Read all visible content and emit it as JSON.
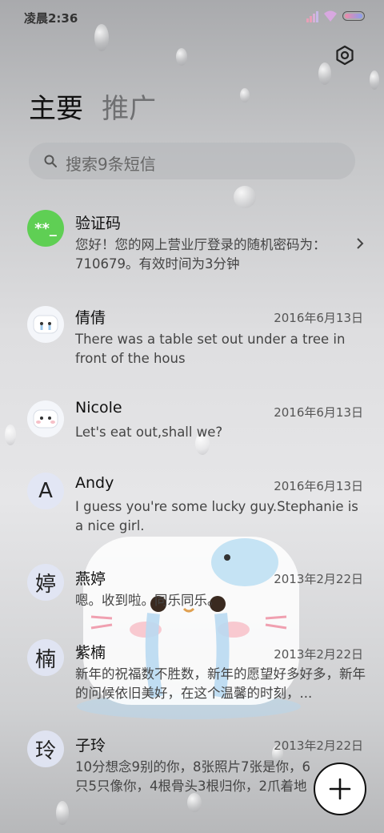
{
  "status_bar": {
    "time": "凌晨2:36"
  },
  "tabs": [
    {
      "label": "主要"
    },
    {
      "label": "推广"
    }
  ],
  "search": {
    "placeholder": "搜索9条短信"
  },
  "messages": [
    {
      "avatar": "**_",
      "name": "验证码",
      "date": "",
      "preview": "您好！您的网上营业厅登录的随机密码为：710679。有效时间为3分钟"
    },
    {
      "avatar": "cat-sticker",
      "name": "倩倩",
      "date": "2016年6月13日",
      "preview": "There was a table set out under a tree in front of the hous"
    },
    {
      "avatar": "cat-sticker",
      "name": "Nicole",
      "date": "2016年6月13日",
      "preview": "Let's eat out,shall we?"
    },
    {
      "avatar": "A",
      "name": "Andy",
      "date": "2016年6月13日",
      "preview": "I guess you're some lucky guy.Stephanie is a nice girl."
    },
    {
      "avatar": "婷",
      "name": "燕婷",
      "date": "2013年2月22日",
      "preview": "嗯。收到啦。同乐同乐。"
    },
    {
      "avatar": "楠",
      "name": "紫楠",
      "date": "2013年2月22日",
      "preview": "新年的祝福数不胜数，新年的愿望好多好多，新年的问候依旧美好，在这个温馨的时刻，..."
    },
    {
      "avatar": "玲",
      "name": "子玲",
      "date": "2013年2月22日",
      "preview": "10分想念9别的你，8张照片7张是你，6只5只像你，4根骨头3根归你，2爪着地1..."
    }
  ],
  "icons": {
    "settings": "gear-icon",
    "search": "search-icon",
    "compose": "plus-icon"
  },
  "colors": {
    "code_avatar": "#5fcf54",
    "fab_bg": "#ffffff"
  }
}
